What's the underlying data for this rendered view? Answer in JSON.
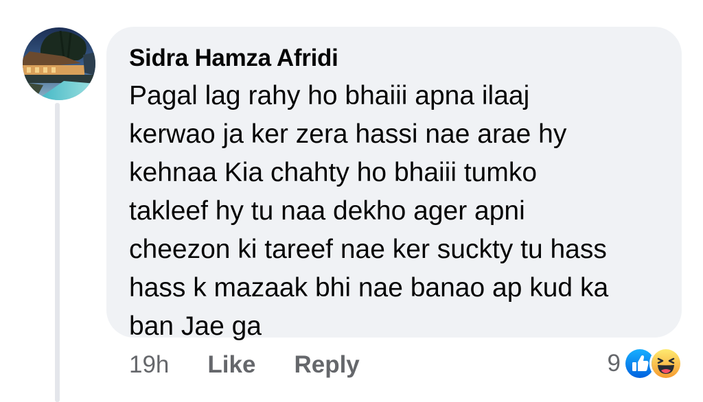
{
  "comment": {
    "author": "Sidra Hamza Afridi",
    "text": "Pagal lag rahy ho bhaiii apna ilaaj\nkerwao ja ker zera hassi nae arae hy\nkehnaa Kia chahty ho bhaiii tumko\ntakleef hy tu naa dekho ager apni\ncheezon ki tareef nae ker suckty tu hass\nhass k mazaak bhi nae banao ap kud ka\nban Jae ga",
    "avatar_icon": "avatar-beach-resort-photo"
  },
  "actions": {
    "timestamp": "19h",
    "like_label": "Like",
    "reply_label": "Reply"
  },
  "reactions": {
    "count": "9",
    "icons": [
      "like-icon",
      "haha-icon"
    ]
  },
  "colors": {
    "bubble_bg": "#f0f2f5",
    "text": "#050505",
    "secondary_text": "#65676b",
    "like_blue": "#1877f2",
    "haha_yellow": "#f7b928"
  }
}
